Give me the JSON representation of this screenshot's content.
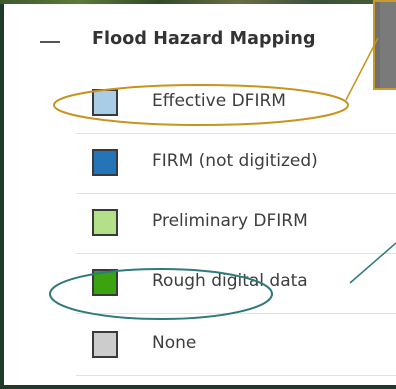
{
  "legend": {
    "title": "Flood Hazard Mapping",
    "items": [
      {
        "label": "Effective DFIRM",
        "color": "#a9cde6"
      },
      {
        "label": "FIRM (not digitized)",
        "color": "#2474b8"
      },
      {
        "label": "Preliminary DFIRM",
        "color": "#b4e08a"
      },
      {
        "label": "Rough digital data",
        "color": "#3aa30f"
      },
      {
        "label": "None",
        "color": "#cccccc"
      }
    ]
  },
  "annotations": {
    "highlight_color_1": "#c8931e",
    "highlight_color_2": "#2f7a7a"
  }
}
